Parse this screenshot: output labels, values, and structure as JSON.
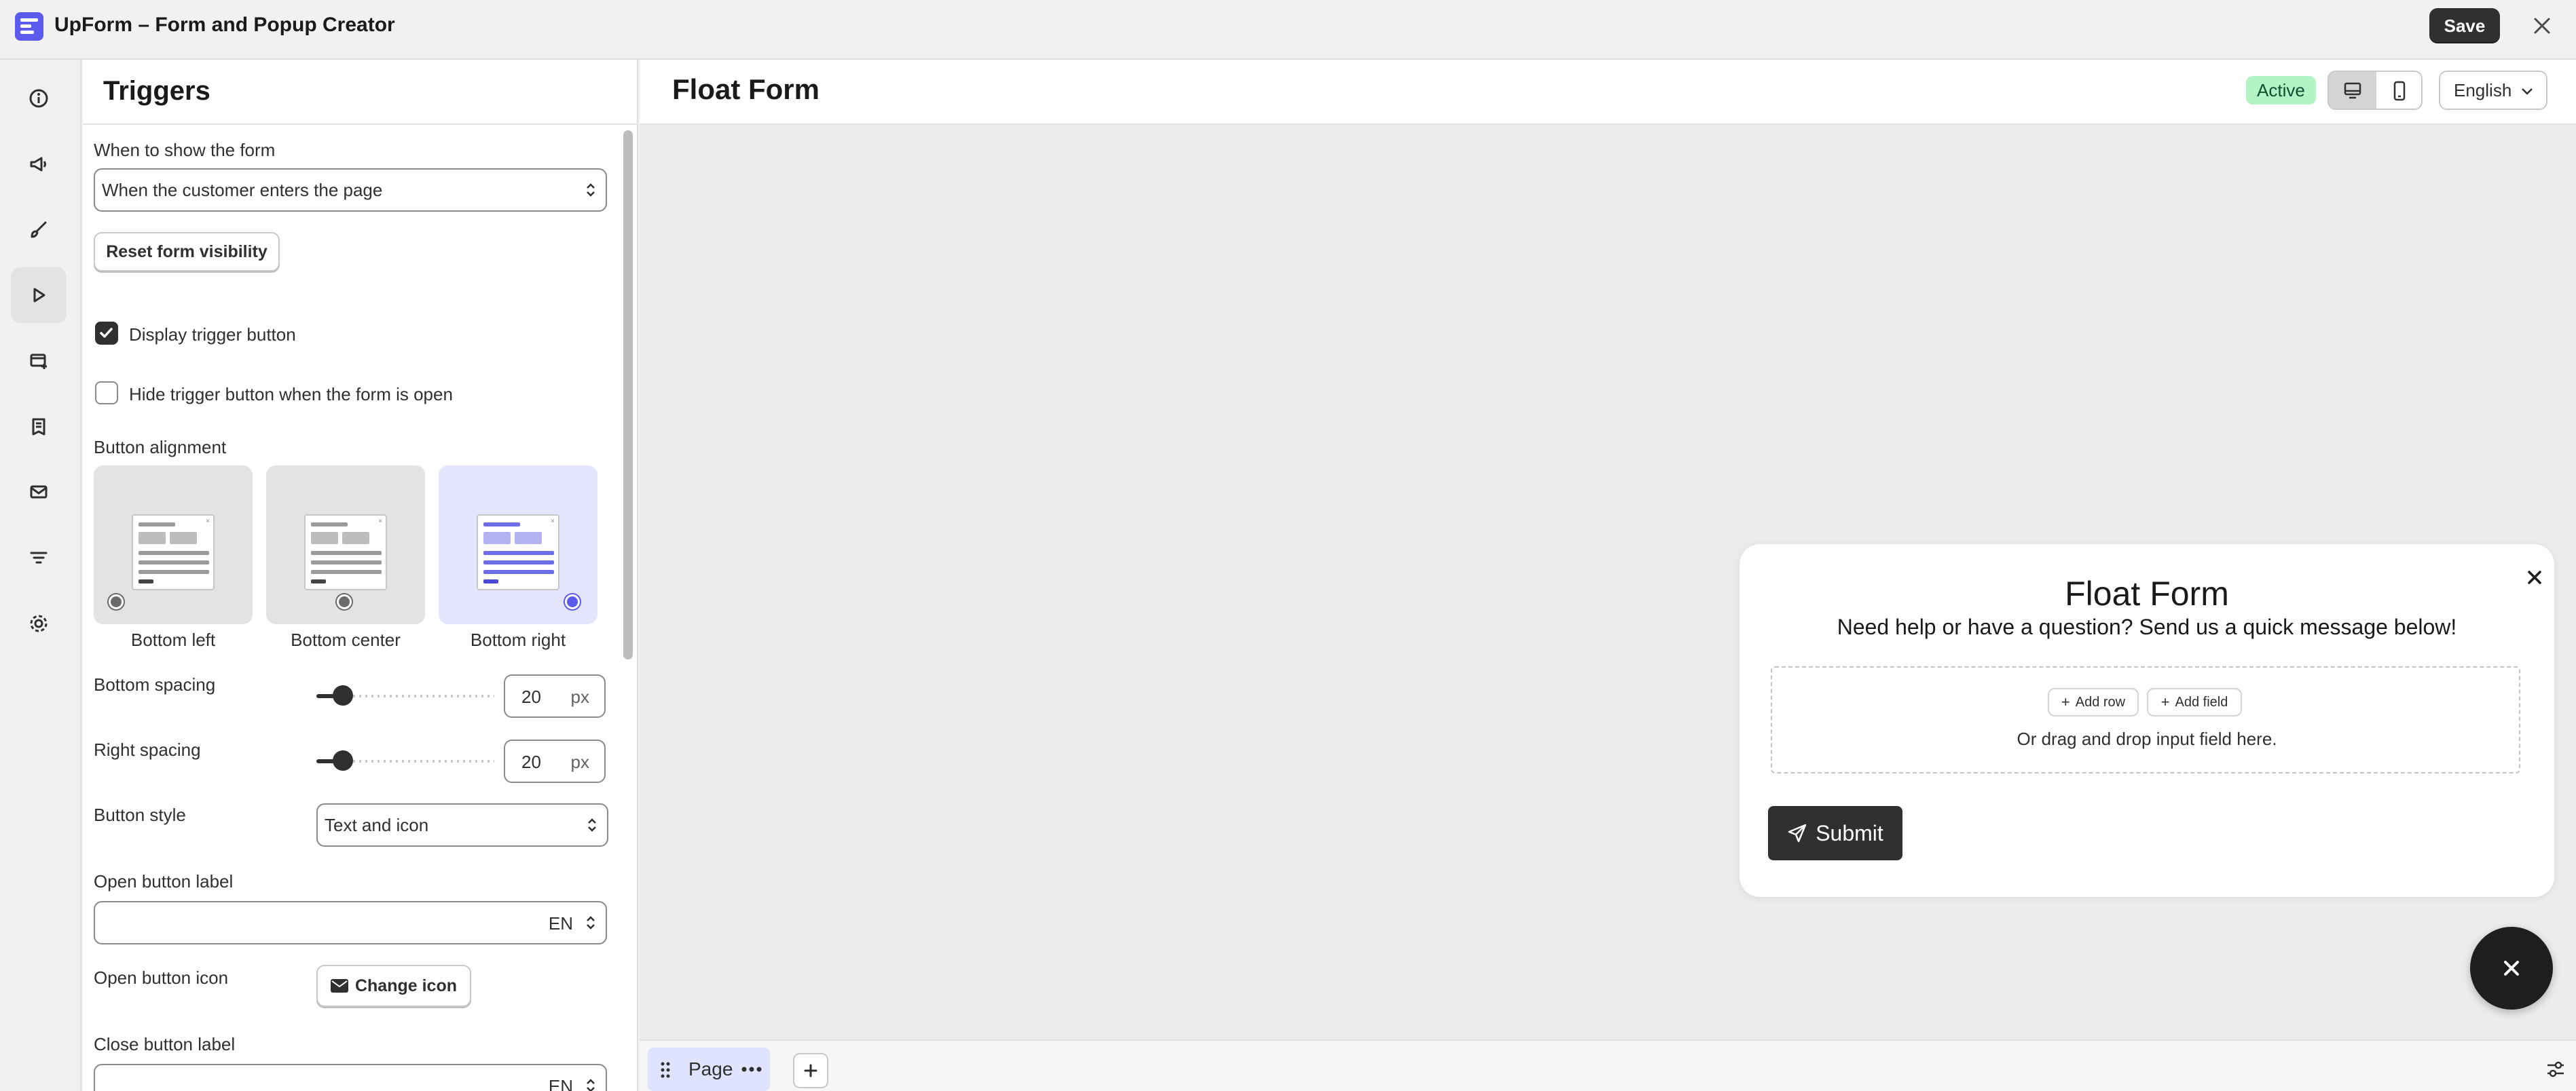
{
  "app": {
    "title": "UpForm – Form and Popup Creator",
    "save_label": "Save"
  },
  "rail": {
    "items": [
      {
        "name": "info",
        "icon": "info-icon"
      },
      {
        "name": "announcement",
        "icon": "megaphone-icon"
      },
      {
        "name": "design",
        "icon": "brush-icon"
      },
      {
        "name": "triggers",
        "icon": "play-icon",
        "active": true
      },
      {
        "name": "forms",
        "icon": "forms-icon"
      },
      {
        "name": "integrations",
        "icon": "receipt-icon"
      },
      {
        "name": "email",
        "icon": "mail-icon"
      },
      {
        "name": "filters",
        "icon": "filter-icon"
      },
      {
        "name": "settings",
        "icon": "gear-icon"
      }
    ]
  },
  "panel": {
    "title": "Triggers",
    "when_label": "When to show the form",
    "when_value": "When the customer enters the page",
    "reset_label": "Reset form visibility",
    "display_trigger_label": "Display trigger button",
    "display_trigger_checked": true,
    "hide_trigger_label": "Hide trigger button when the form is open",
    "hide_trigger_checked": false,
    "alignment_label": "Button alignment",
    "alignments": [
      "Bottom left",
      "Bottom center",
      "Bottom right"
    ],
    "alignment_selected": "Bottom right",
    "bottom_spacing_label": "Bottom spacing",
    "bottom_spacing_value": "20",
    "right_spacing_label": "Right spacing",
    "right_spacing_value": "20",
    "unit": "px",
    "button_style_label": "Button style",
    "button_style_value": "Text and icon",
    "open_label_label": "Open button label",
    "open_label_lang": "EN",
    "open_icon_label": "Open button icon",
    "change_icon_label": "Change icon",
    "close_label_label": "Close button label",
    "close_label_lang": "EN"
  },
  "canvas": {
    "title": "Float Form",
    "status": "Active",
    "language": "English",
    "form": {
      "title": "Float Form",
      "subtitle": "Need help or have a question? Send us a quick message below!",
      "add_row": "Add row",
      "add_field": "Add field",
      "drop_hint": "Or drag and drop input field here.",
      "submit": "Submit"
    },
    "page_tab": "Page"
  },
  "colors": {
    "accent": "#5b5bf0",
    "dark": "#303030",
    "active_badge": "#b4f3c4"
  }
}
